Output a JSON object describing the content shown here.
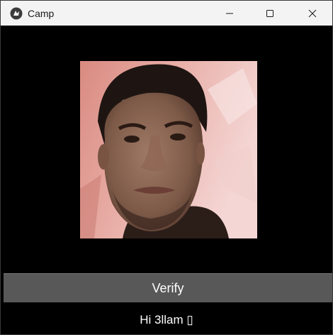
{
  "window": {
    "title": "Camp",
    "app_icon": "kivy-logo-icon",
    "controls": {
      "minimize": "minimize-icon",
      "maximize": "maximize-icon",
      "close": "close-icon"
    }
  },
  "main": {
    "camera_feed_icon": "webcam-face-image",
    "verify_label": "Verify",
    "status_text": "Hi 3llam ▯"
  },
  "colors": {
    "titlebar_bg": "#f3f3f3",
    "content_bg": "#000000",
    "button_bg": "#585858",
    "text": "#ffffff"
  }
}
